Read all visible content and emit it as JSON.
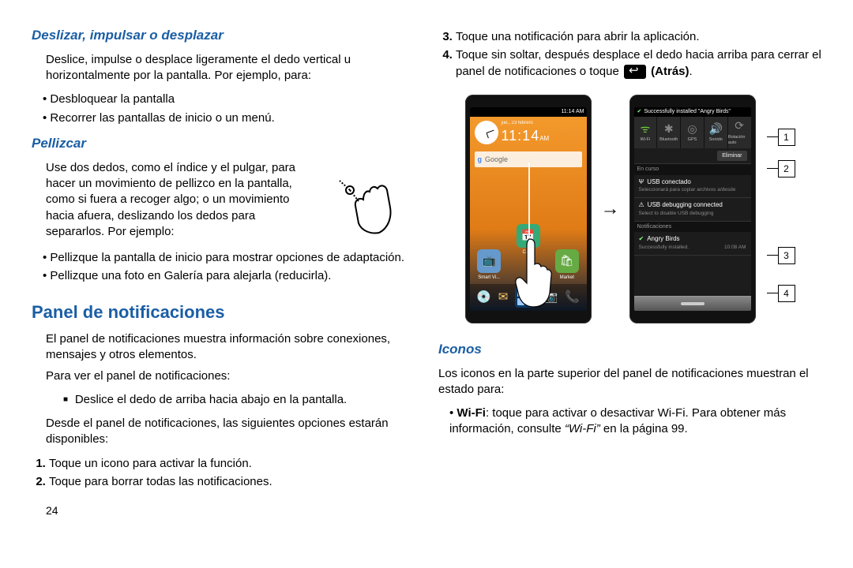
{
  "left": {
    "h_slide": "Deslizar, impulsar o desplazar",
    "p_slide": "Deslice, impulse o desplace ligeramente el dedo vertical u horizontalmente por la pantalla. Por ejemplo, para:",
    "slide_bul1": "Desbloquear la pantalla",
    "slide_bul2": "Recorrer las pantallas de inicio o un menú.",
    "h_pinch": "Pellizcar",
    "p_pinch": "Use dos dedos, como el índice y el pulgar, para hacer un movimiento de pellizco en la pantalla, como si fuera a recoger algo; o un movimiento hacia afuera, deslizando los dedos para separarlos. Por ejemplo:",
    "pinch_bul1": "Pellizque la pantalla de inicio para mostrar opciones de adaptación.",
    "pinch_bul2": "Pellizque una foto en Galería para alejarla (reducirla).",
    "h_panel": "Panel de notificaciones",
    "p_panel1": "El panel de notificaciones muestra información sobre conexiones, mensajes y otros elementos.",
    "p_panel2": "Para ver el panel de notificaciones:",
    "panel_sq1": "Deslice el dedo de arriba hacia abajo en la pantalla.",
    "p_panel3": "Desde el panel de notificaciones, las siguientes opciones estarán disponibles:",
    "step1": "Toque un icono para activar la función.",
    "step2": "Toque para borrar todas las notificaciones.",
    "page": "24"
  },
  "right": {
    "step3": "Toque una notificación para abrir la aplicación.",
    "step4a": "Toque sin soltar, después desplace el dedo hacia arriba para cerrar el panel de notificaciones o toque ",
    "step4b": " (Atrás)",
    "step4c": ".",
    "h_icons": "Iconos",
    "p_icons": "Los iconos en la parte superior del panel de notificaciones muestran el estado para:",
    "wifi_bold": "Wi-Fi",
    "wifi_rest": ": toque para activar o desactivar Wi-Fi. Para obtener más información, consulte ",
    "wifi_ref": "“Wi-Fi”",
    "wifi_page": " en la página 99."
  },
  "phone_left": {
    "status_time": "11:14 AM",
    "date_line": "jue., 23 febrero",
    "time_digits": "11:14",
    "time_ampm": "AM",
    "search_g": "g",
    "search_placeholder": "Google",
    "icon1_label": "Cal...",
    "icon2_label": "Smart Vi...",
    "icon3_label": "Market"
  },
  "phone_right": {
    "install_msg": "Successfully installed \"Angry Birds\"",
    "toggles": [
      {
        "label": "Wi-Fi",
        "glyph": "�ói",
        "class": "tog-on",
        "icon": "wifi"
      },
      {
        "label": "Bluetooth",
        "glyph": "B",
        "class": "tog-off",
        "icon": "bluetooth"
      },
      {
        "label": "GPS",
        "glyph": "◎",
        "class": "tog-off",
        "icon": "gps"
      },
      {
        "label": "Sonido",
        "glyph": "🔊",
        "class": "tog-on",
        "icon": "sound"
      },
      {
        "label": "Rotación auto",
        "glyph": "⟳",
        "class": "tog-off",
        "icon": "rotation"
      }
    ],
    "clear": "Eliminar",
    "sec_ongoing": "En curso",
    "n1_title": "USB conectado",
    "n1_sub": "Seleccionará para copiar archivos a/desde",
    "n2_title": "USB debugging connected",
    "n2_sub": "Select to disable USB debugging",
    "sec_notif": "Notificaciones",
    "n3_title": "Angry Birds",
    "n3_sub": "Successfully installed.",
    "n3_time": "10:08 AM"
  },
  "callouts": {
    "c1": "1",
    "c2": "2",
    "c3": "3",
    "c4": "4"
  }
}
